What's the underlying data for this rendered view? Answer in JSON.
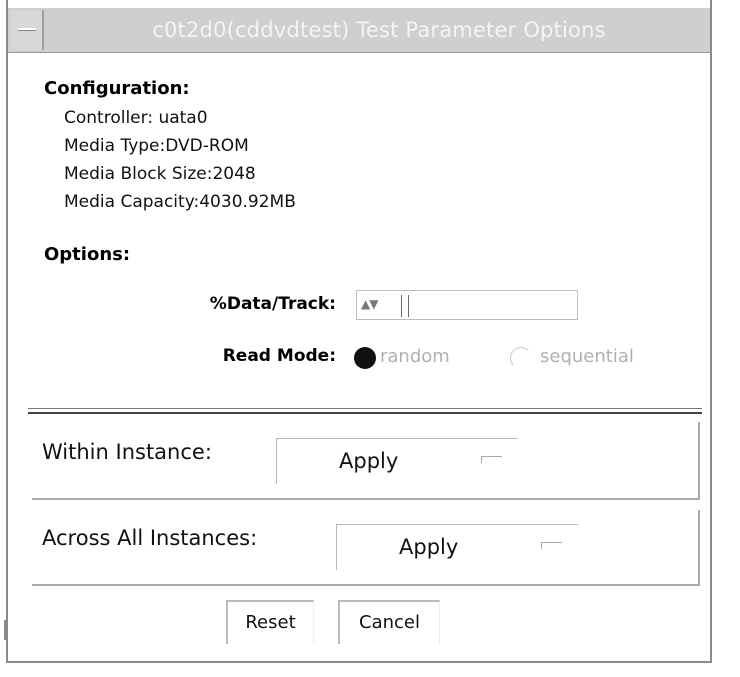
{
  "window": {
    "title": "c0t2d0(cddvdtest) Test Parameter Options"
  },
  "configuration": {
    "heading": "Configuration:",
    "controller": "Controller: uata0",
    "media_type": "Media Type:DVD-ROM",
    "block_size": "Media Block Size:2048",
    "capacity": "Media Capacity:4030.92MB"
  },
  "options": {
    "heading": "Options:",
    "data_track_label": "%Data/Track:",
    "data_track_value": "",
    "read_mode_label": "Read Mode:",
    "read_mode_options": [
      "random",
      "sequential"
    ],
    "read_mode_selected": "random"
  },
  "within_instance": {
    "label": "Within Instance:",
    "button": "Apply"
  },
  "across_instances": {
    "label": "Across All Instances:",
    "button": "Apply"
  },
  "footer": {
    "reset": "Reset",
    "cancel": "Cancel"
  },
  "colors": {
    "titlebar_bg": "#cfcfcf",
    "title_text": "#f4f4f4",
    "disabled_text": "#b0b0b0"
  },
  "icons": {
    "window_menu": "window-menu-icon",
    "spinner": "spinner-arrows-icon",
    "radio_selected": "radio-selected-icon",
    "radio_unselected": "radio-unselected-icon"
  }
}
